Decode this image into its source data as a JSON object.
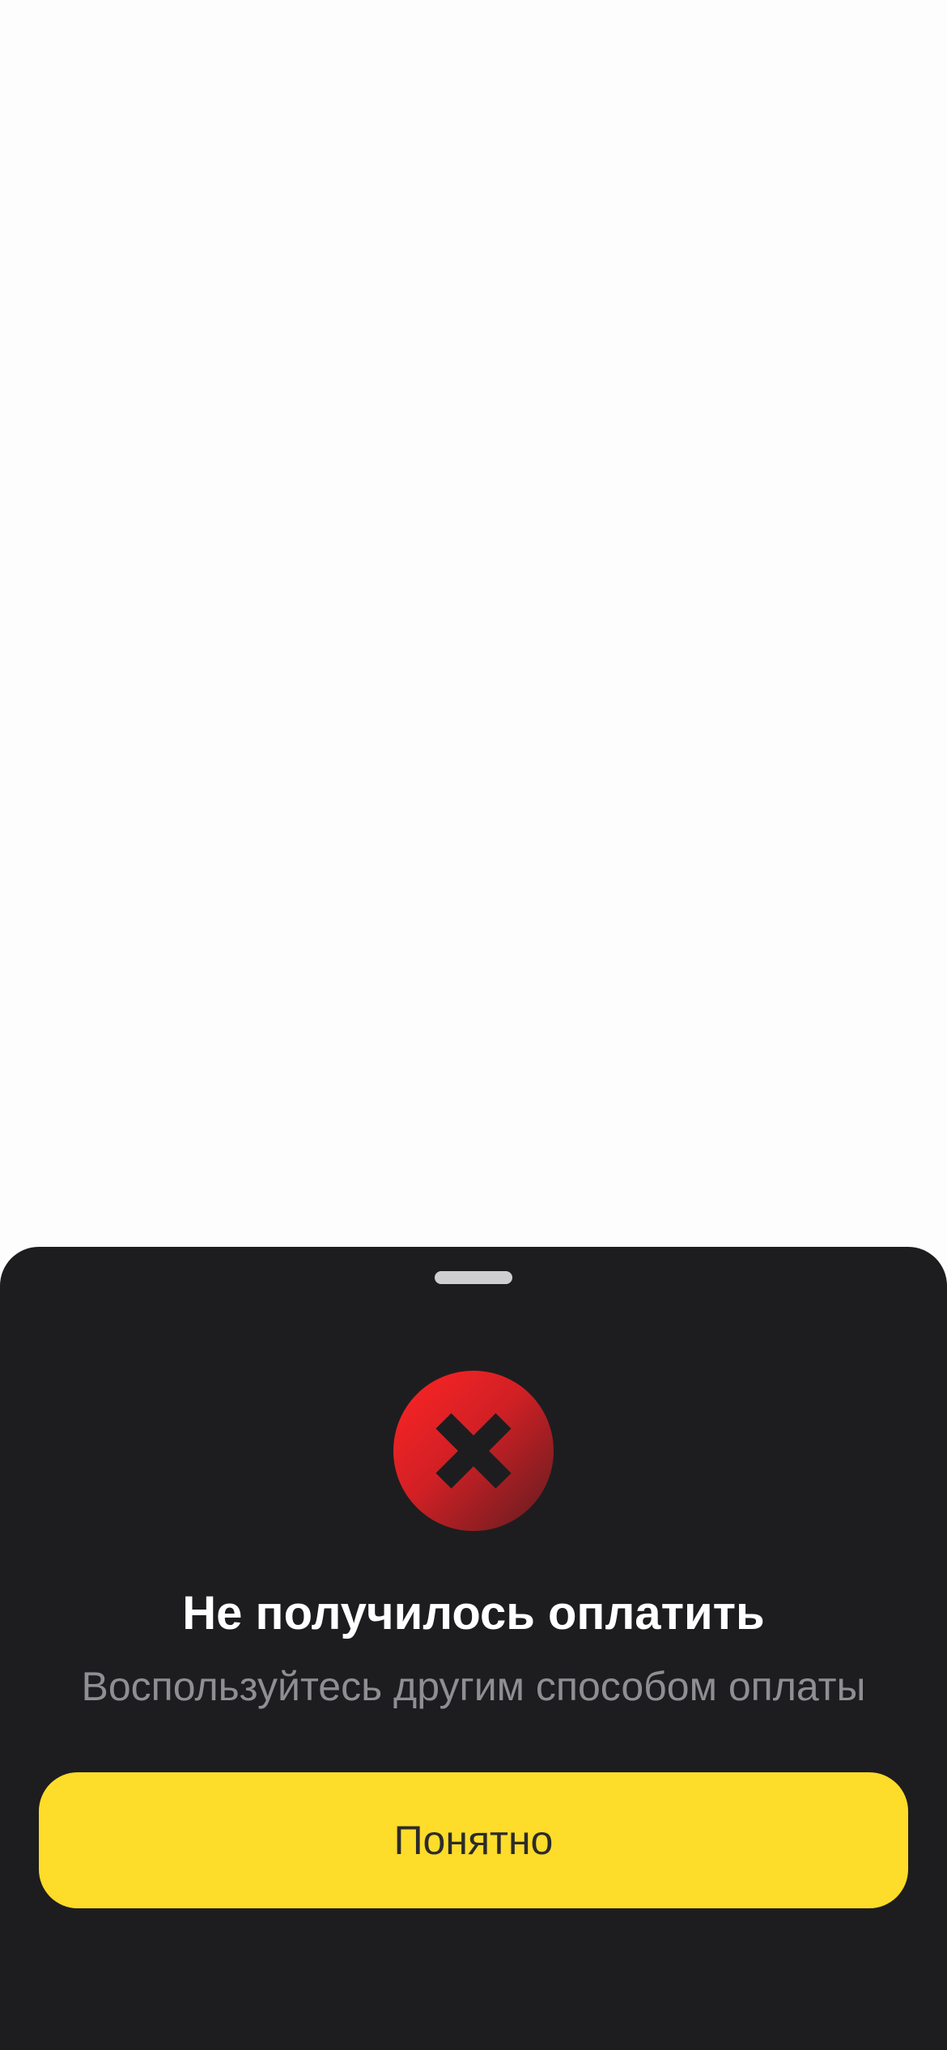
{
  "error_sheet": {
    "title": "Не получилось оплатить",
    "subtitle": "Воспользуйтесь другим способом оплаты",
    "button_label": "Понятно",
    "icon": "error-x-circle-icon"
  },
  "colors": {
    "page_background": "#fdfdfd",
    "sheet_background": "#1d1d1f",
    "grabber": "#cfcfd2",
    "error_red_light": "#e8252a",
    "error_red_dark": "#6e1d20",
    "title_text": "#ffffff",
    "subtitle_text": "#8e8e93",
    "button_background": "#fedc2a",
    "button_text": "#2b2b2b"
  }
}
